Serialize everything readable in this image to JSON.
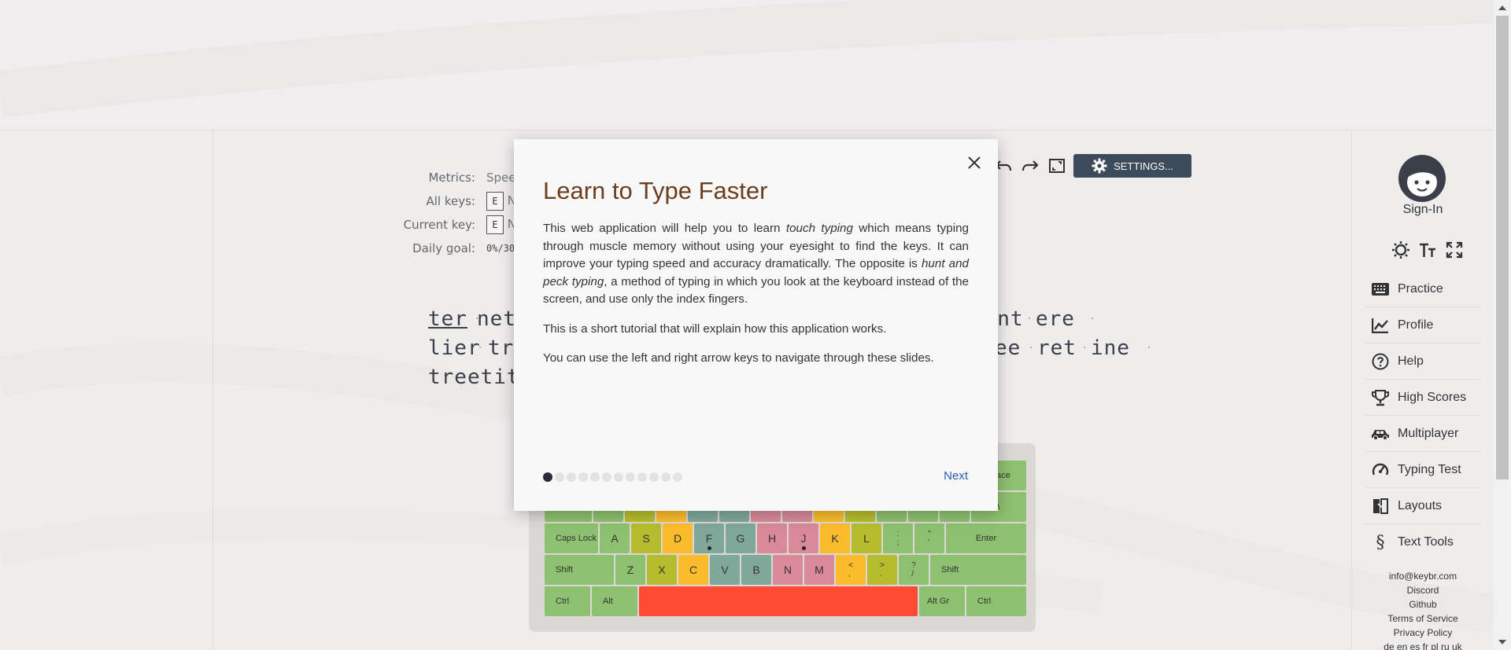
{
  "metrics": {
    "rows": [
      {
        "label": "Metrics:",
        "value": "Spee"
      },
      {
        "label": "All keys:",
        "key": "E",
        "value": "N"
      },
      {
        "label": "Current key:",
        "key": "E",
        "value": "N"
      },
      {
        "label": "Daily goal:",
        "value": "0%/30"
      }
    ]
  },
  "toolbar": {
    "settings_label": "SETTINGS..."
  },
  "typing": {
    "line1_left": "ter",
    "line1_mid": "netr",
    "line1_right": "ient",
    "line1_right2": "ere",
    "line2_left": "lier",
    "line2_mid": "tre",
    "line2_right": "ee",
    "line2_right2": "ret",
    "line2_right3": "ine",
    "line3_left": "treetit"
  },
  "keyboard": {
    "row1_tail_label": "ace",
    "row2_brackets": [
      "[",
      "]",
      "\\"
    ],
    "home": [
      "Caps Lock",
      "A",
      "S",
      "D",
      "F",
      "G",
      "H",
      "J",
      "K",
      "L",
      ":\n;",
      "\"\n'",
      "Enter"
    ],
    "bottom": [
      "Shift",
      "Z",
      "X",
      "C",
      "V",
      "B",
      "N",
      "M",
      "<\n,",
      ">\n.",
      "?\n/",
      "Shift"
    ],
    "space_row": [
      "Ctrl",
      "Alt",
      "Alt Gr",
      "Ctrl"
    ]
  },
  "sidebar": {
    "signin_label": "Sign-In",
    "nav": [
      {
        "icon": "keyboard-icon",
        "label": "Practice"
      },
      {
        "icon": "chart-icon",
        "label": "Profile"
      },
      {
        "icon": "help-icon",
        "label": "Help"
      },
      {
        "icon": "trophy-icon",
        "label": "High Scores"
      },
      {
        "icon": "car-icon",
        "label": "Multiplayer"
      },
      {
        "icon": "speedometer-icon",
        "label": "Typing Test"
      },
      {
        "icon": "layouts-icon",
        "label": "Layouts"
      },
      {
        "icon": "section-icon",
        "label": "Text Tools"
      }
    ],
    "footer": [
      "info@keybr.com",
      "Discord",
      "Github",
      "Terms of Service",
      "Privacy Policy",
      "de en es fr pl ru uk"
    ]
  },
  "modal": {
    "title": "Learn to Type Faster",
    "p1_a": "This web application will help you to learn ",
    "p1_b": "touch typing",
    "p1_c": " which means typing through muscle memory without using your eyesight to find the keys. It can improve your typing speed and accuracy dramatically. The opposite is ",
    "p1_d": "hunt and peck typing",
    "p1_e": ", a method of typing in which you look at the keyboard instead of the screen, and use only the index fingers.",
    "p2": "This is a short tutorial that will explain how this application works.",
    "p3": "You can use the left and right arrow keys to navigate through these slides.",
    "next_label": "Next",
    "slides_total": 12,
    "slide_current": 1
  }
}
